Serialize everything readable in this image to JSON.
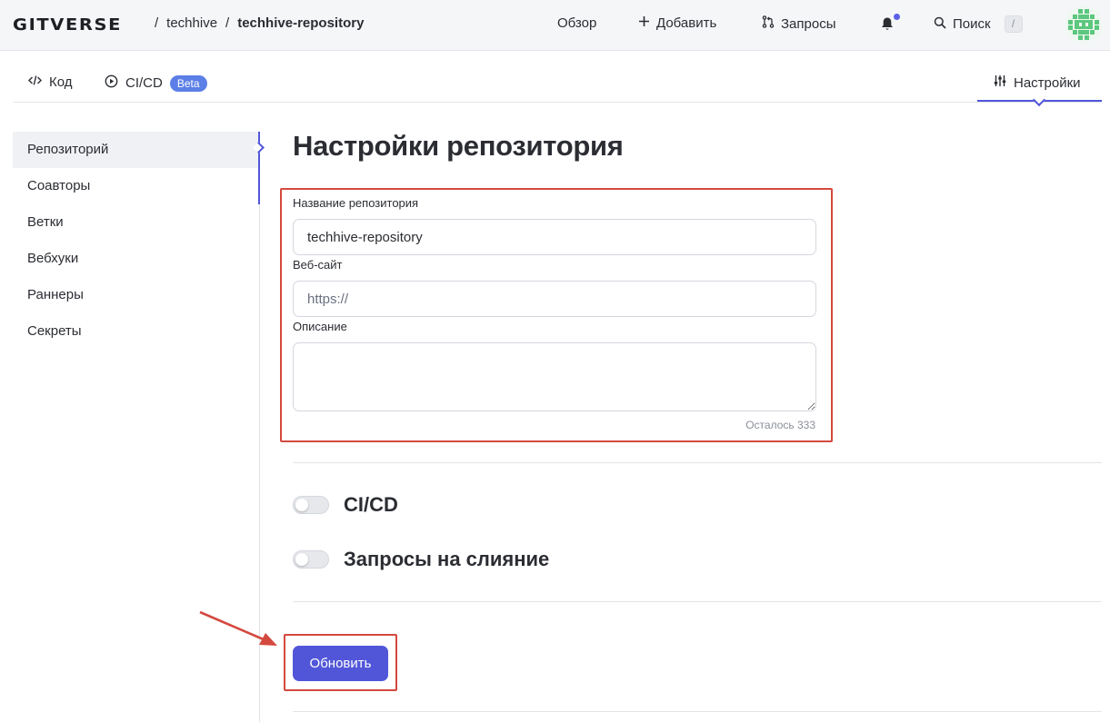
{
  "header": {
    "logo": "GITVERSE",
    "breadcrumb": {
      "owner": "techhive",
      "repo": "techhive-repository",
      "separator": "/"
    },
    "nav": {
      "overview": "Обзор",
      "add": "Добавить",
      "requests": "Запросы",
      "search": "Поиск",
      "search_shortcut": "/"
    }
  },
  "tabs": {
    "code": "Код",
    "cicd": "CI/CD",
    "cicd_badge": "Beta",
    "settings": "Настройки"
  },
  "sidebar": {
    "items": [
      {
        "label": "Репозиторий",
        "active": true
      },
      {
        "label": "Соавторы"
      },
      {
        "label": "Ветки"
      },
      {
        "label": "Вебхуки"
      },
      {
        "label": "Раннеры"
      },
      {
        "label": "Секреты"
      }
    ]
  },
  "main": {
    "title": "Настройки репозитория",
    "form": {
      "name_label": "Название репозитория",
      "name_value": "techhive-repository",
      "website_label": "Веб-сайт",
      "website_placeholder": "https://",
      "description_label": "Описание",
      "description_value": "",
      "remaining": "Осталось 333"
    },
    "toggles": {
      "cicd": "CI/CD",
      "merge_requests": "Запросы на слияние"
    },
    "submit": "Обновить"
  },
  "colors": {
    "accent": "#5156d9",
    "highlight": "#d4493e",
    "badge": "#5b7fe6"
  }
}
